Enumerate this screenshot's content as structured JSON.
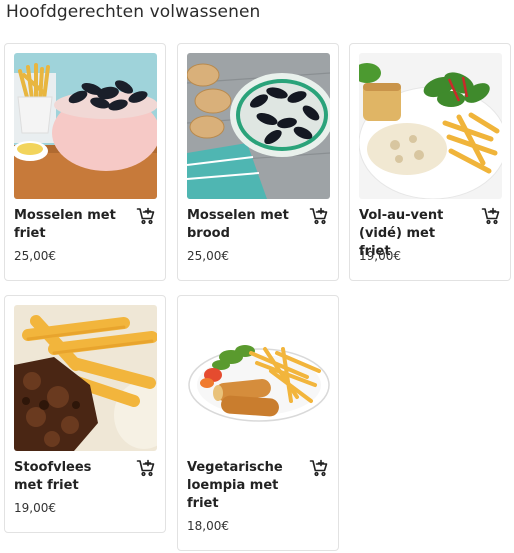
{
  "section": {
    "title": "Hoofdgerechten volwassenen"
  },
  "products": [
    {
      "name": "Mosselen met friet",
      "price": "25,00€",
      "image": "mussels-pot-with-fries-photo",
      "cart_icon": "add-to-cart-icon"
    },
    {
      "name": "Mosselen met brood",
      "price": "25,00€",
      "image": "mussels-dish-with-bread-photo",
      "cart_icon": "add-to-cart-icon"
    },
    {
      "name": "Vol-au-vent (vidé) met friet",
      "price": "19,00€",
      "image": "vol-au-vent-with-fries-photo",
      "cart_icon": "add-to-cart-icon"
    },
    {
      "name": "Stoofvlees met friet",
      "price": "19,00€",
      "image": "beef-stew-with-fries-photo",
      "cart_icon": "add-to-cart-icon"
    },
    {
      "name": "Vegetarische loempia met friet",
      "price": "18,00€",
      "image": "vegetarian-springroll-with-fries-photo",
      "cart_icon": "add-to-cart-icon"
    }
  ],
  "colors": {
    "card_border": "#e2e2e2",
    "text": "#222222"
  }
}
